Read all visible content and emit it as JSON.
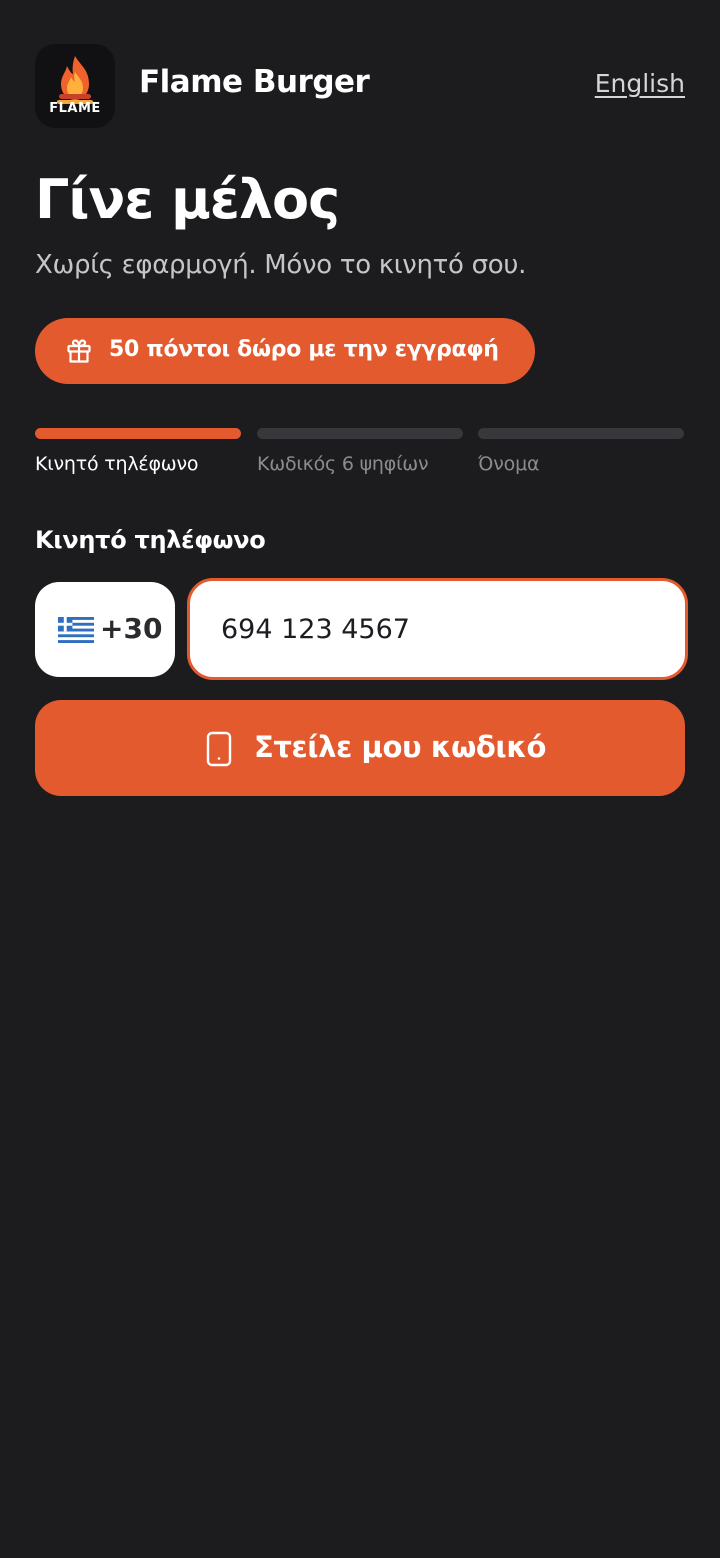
{
  "header": {
    "logo_text": "FLAME",
    "brand_name": "Flame Burger",
    "language_link": "English"
  },
  "main": {
    "title": "Γίνε μέλος",
    "subtitle": "Χωρίς εφαρμογή. Μόνο το κινητό σου.",
    "promo": {
      "icon": "gift-icon",
      "label": "50 πόντοι δώρο με την εγγραφή"
    },
    "steps": [
      {
        "label": "Κινητό τηλέφωνο",
        "active": true
      },
      {
        "label": "Κωδικός 6 ψηφίων",
        "active": false
      },
      {
        "label": "Όνομα",
        "active": false
      }
    ],
    "phone_field": {
      "label": "Κινητό τηλέφωνο",
      "country_flag": "greece-flag-icon",
      "country_code": "+30",
      "value": "694 123 4567"
    },
    "submit": {
      "icon": "smartphone-icon",
      "label": "Στείλε μου κωδικό"
    }
  },
  "colors": {
    "background": "#1c1b1e",
    "accent": "#e45a2f",
    "inactive_step": "#38373b",
    "input_background": "#ffffff"
  }
}
